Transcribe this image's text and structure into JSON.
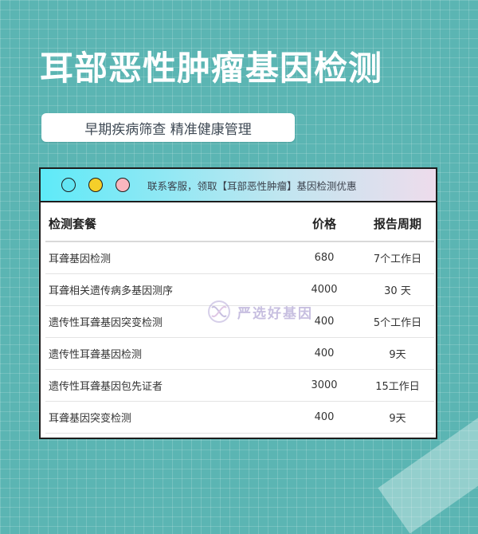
{
  "title": "耳部恶性肿瘤基因检测",
  "subtitle": "早期疾病筛查 精准健康管理",
  "card": {
    "header_note": "联系客服，领取【耳部恶性肿瘤】基因检测优惠",
    "columns": [
      "检测套餐",
      "价格",
      "报告周期"
    ],
    "rows": [
      [
        "耳聋基因检测",
        "680",
        "7个工作日"
      ],
      [
        "耳聋相关遗传病多基因测序",
        "4000",
        "30 天"
      ],
      [
        "遗传性耳聋基因突变检测",
        "400",
        "5个工作日"
      ],
      [
        "遗传性耳聋基因检测",
        "400",
        "9天"
      ],
      [
        "遗传性耳聋基因包先证者",
        "3000",
        "15工作日"
      ],
      [
        "耳聋基因突变检测",
        "400",
        "9天"
      ]
    ]
  },
  "watermark": {
    "text": "严选好基因",
    "icon": "dna-logo-icon"
  },
  "colors": {
    "background": "#5bb5b3",
    "header_gradient_start": "#5eeaf8",
    "header_gradient_end": "#eedcec"
  }
}
